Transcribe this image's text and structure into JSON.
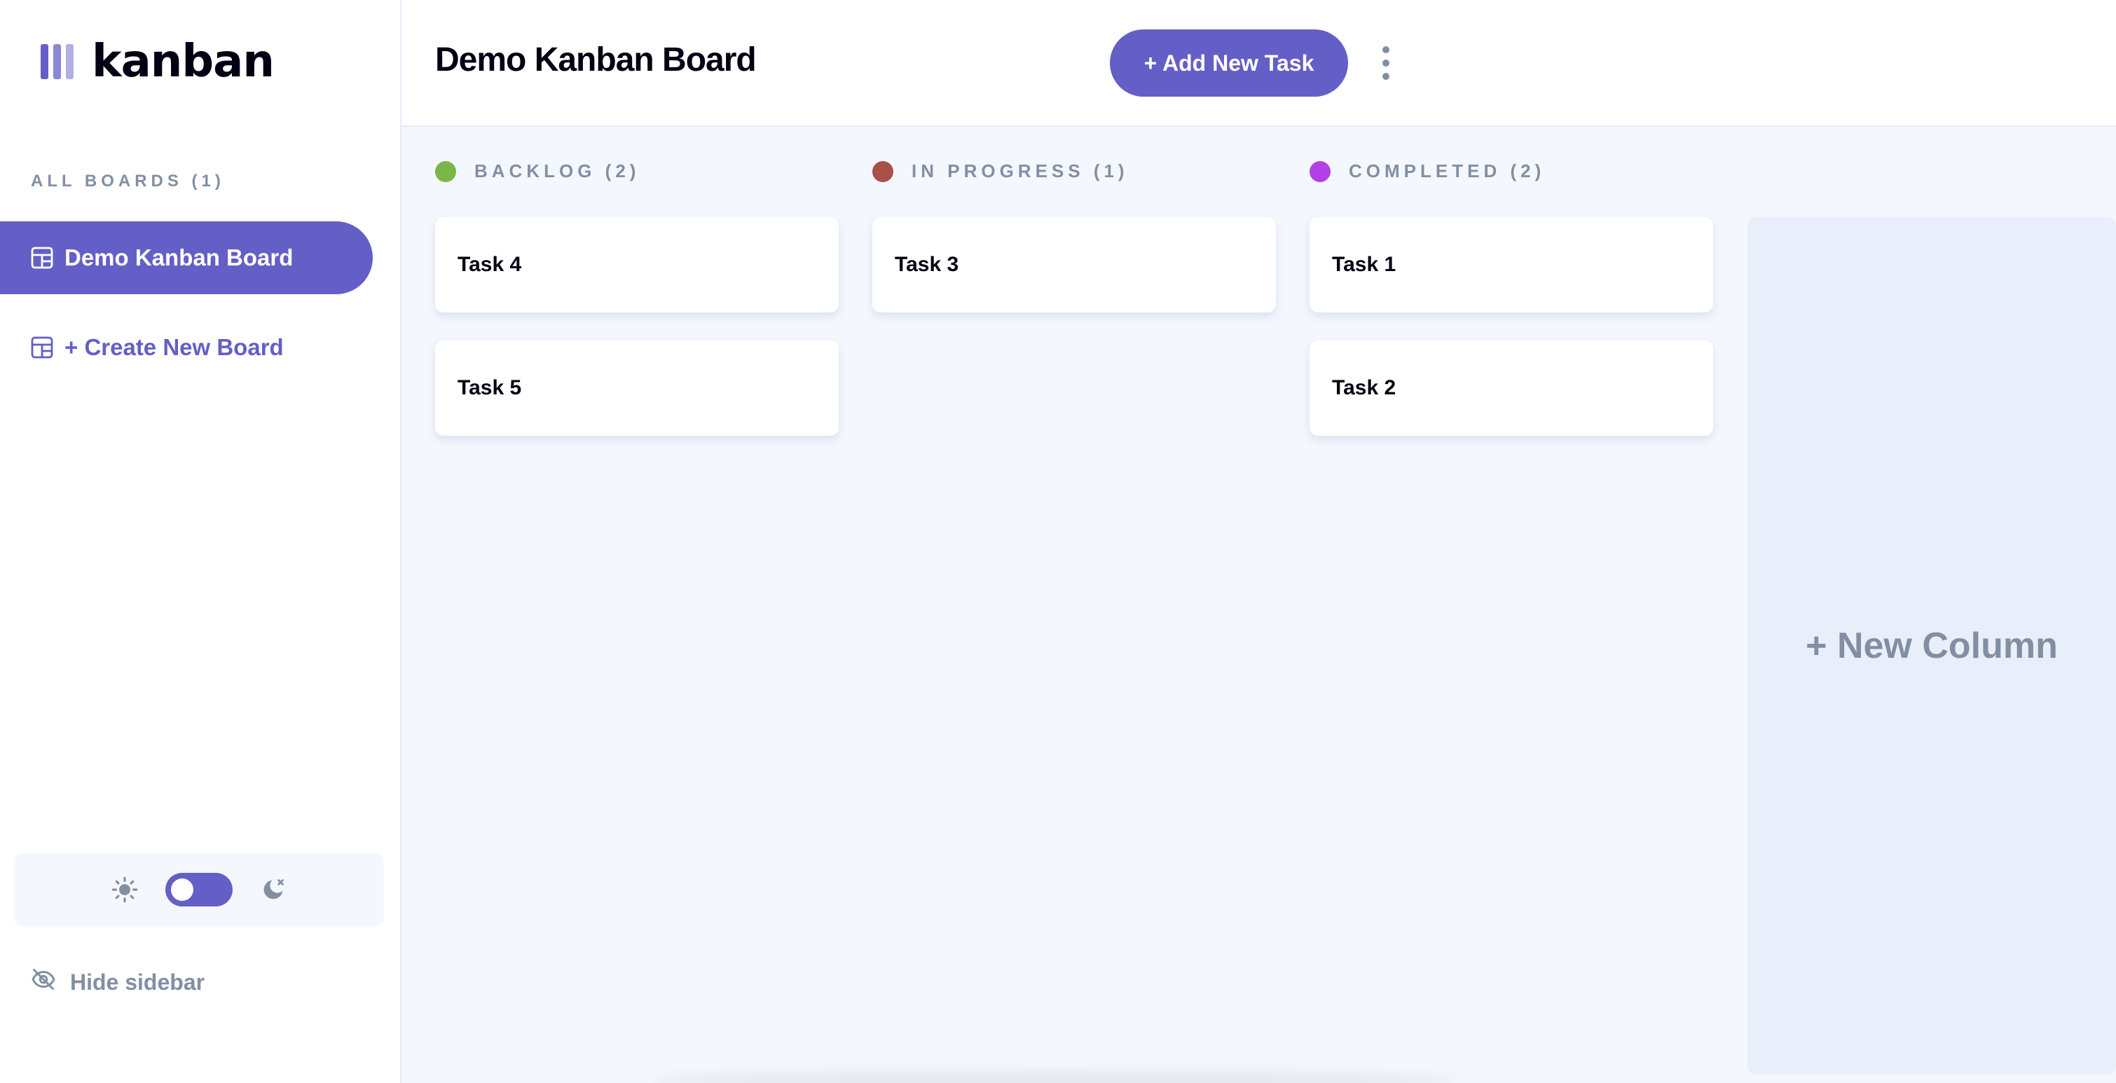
{
  "sidebar": {
    "logo_text": "kanban",
    "all_boards_label": "ALL BOARDS (1)",
    "boards": [
      {
        "label": "Demo Kanban Board"
      }
    ],
    "create_board_label": "+ Create New Board",
    "hide_sidebar_label": "Hide sidebar",
    "theme": {
      "light_icon": "sun-icon",
      "dark_icon": "moon-icon",
      "dark_mode": false
    }
  },
  "header": {
    "title": "Demo Kanban Board",
    "add_task_label": "+ Add New Task",
    "more_icon": "vertical-ellipsis-icon"
  },
  "columns": [
    {
      "title": "BACKLOG (2)",
      "color": "#7ab648",
      "tasks": [
        "Task 4",
        "Task 5"
      ]
    },
    {
      "title": "IN PROGRESS (1)",
      "color": "#a8504a",
      "tasks": [
        "Task 3"
      ]
    },
    {
      "title": "COMPLETED (2)",
      "color": "#b23fe8",
      "tasks": [
        "Task 1",
        "Task 2"
      ]
    }
  ],
  "new_column_label": "+ New Column",
  "colors": {
    "accent": "#635fc7",
    "background": "#f4f7fd",
    "muted_text": "#828fa3"
  }
}
